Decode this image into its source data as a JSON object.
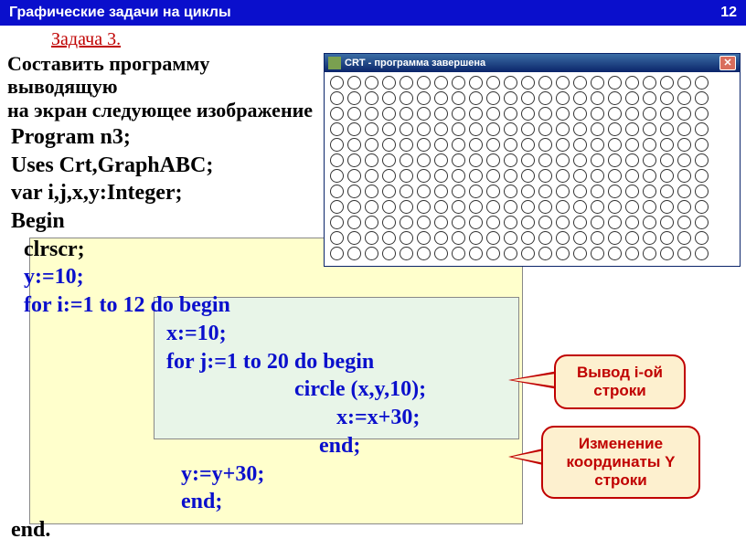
{
  "header": {
    "title": "Графические задачи на циклы",
    "page": "12"
  },
  "task": {
    "num": "Задача 3.",
    "desc1": "Составить программу выводящую",
    "desc2": "на экран следующее изображение"
  },
  "code": {
    "l1": "Program n3;",
    "l2": "Uses Crt,GraphABC;",
    "l3": "var i,j,x,y:Integer;",
    "l4": "Begin",
    "l5": "clrscr;",
    "l6": "y:=10;",
    "l7": "for i:=1 to 12 do begin",
    "l8": "x:=10;",
    "l9": "for j:=1 to 20 do begin",
    "l10": "circle (x,y,10);",
    "l11": "x:=x+30;",
    "l12": "end;",
    "l13": "y:=y+30;",
    "l14": "end;",
    "l15": "end."
  },
  "crt": {
    "title": "CRT - программа завершена",
    "rows": 12,
    "cols": 22
  },
  "callouts": {
    "c1a": "Вывод i-ой",
    "c1b": "строки",
    "c2a": "Изменение",
    "c2b": "координаты Y",
    "c2c": "строки"
  }
}
